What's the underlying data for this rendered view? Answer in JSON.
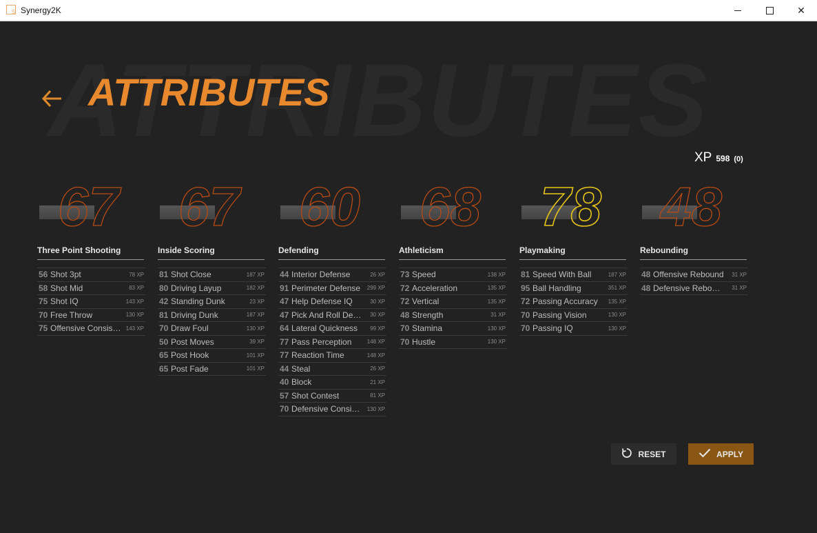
{
  "window": {
    "title": "Synergy2K",
    "icon_letter": "S"
  },
  "header": {
    "background_word": "ATTRIBUTES",
    "title": "ATTRIBUTES",
    "back_icon": "arrow-left-icon"
  },
  "xp": {
    "label": "XP",
    "value": "598",
    "pending": "(0)"
  },
  "colors": {
    "accent": "#e8892e",
    "outline": "#b84a14",
    "highlight": "#e8c419",
    "apply_bg": "#8a5613"
  },
  "categories": [
    {
      "name": "Three Point Shooting",
      "rating": "67",
      "highlight": false,
      "attributes": [
        {
          "value": "56",
          "name": "Shot 3pt",
          "xp": "78 XP"
        },
        {
          "value": "58",
          "name": "Shot Mid",
          "xp": "83 XP"
        },
        {
          "value": "75",
          "name": "Shot IQ",
          "xp": "143 XP"
        },
        {
          "value": "70",
          "name": "Free Throw",
          "xp": "130 XP"
        },
        {
          "value": "75",
          "name": "Offensive Consiste...",
          "xp": "143 XP"
        }
      ]
    },
    {
      "name": "Inside Scoring",
      "rating": "67",
      "highlight": false,
      "attributes": [
        {
          "value": "81",
          "name": "Shot Close",
          "xp": "187 XP"
        },
        {
          "value": "80",
          "name": "Driving Layup",
          "xp": "182 XP"
        },
        {
          "value": "42",
          "name": "Standing Dunk",
          "xp": "23 XP"
        },
        {
          "value": "81",
          "name": "Driving Dunk",
          "xp": "187 XP"
        },
        {
          "value": "70",
          "name": "Draw Foul",
          "xp": "130 XP"
        },
        {
          "value": "50",
          "name": "Post Moves",
          "xp": "39 XP"
        },
        {
          "value": "65",
          "name": "Post Hook",
          "xp": "101 XP"
        },
        {
          "value": "65",
          "name": "Post Fade",
          "xp": "101 XP"
        }
      ]
    },
    {
      "name": "Defending",
      "rating": "60",
      "highlight": false,
      "attributes": [
        {
          "value": "44",
          "name": "Interior Defense",
          "xp": "26 XP"
        },
        {
          "value": "91",
          "name": "Perimeter Defense",
          "xp": "299 XP"
        },
        {
          "value": "47",
          "name": "Help Defense IQ",
          "xp": "30 XP"
        },
        {
          "value": "47",
          "name": "Pick And Roll Defen...",
          "xp": "30 XP"
        },
        {
          "value": "64",
          "name": "Lateral Quickness",
          "xp": "99 XP"
        },
        {
          "value": "77",
          "name": "Pass Perception",
          "xp": "148 XP"
        },
        {
          "value": "77",
          "name": "Reaction Time",
          "xp": "148 XP"
        },
        {
          "value": "44",
          "name": "Steal",
          "xp": "26 XP"
        },
        {
          "value": "40",
          "name": "Block",
          "xp": "21 XP"
        },
        {
          "value": "57",
          "name": "Shot Contest",
          "xp": "81 XP"
        },
        {
          "value": "70",
          "name": "Defensive Consiste...",
          "xp": "130 XP"
        }
      ]
    },
    {
      "name": "Athleticism",
      "rating": "68",
      "highlight": false,
      "attributes": [
        {
          "value": "73",
          "name": "Speed",
          "xp": "138 XP"
        },
        {
          "value": "72",
          "name": "Acceleration",
          "xp": "135 XP"
        },
        {
          "value": "72",
          "name": "Vertical",
          "xp": "135 XP"
        },
        {
          "value": "48",
          "name": "Strength",
          "xp": "31 XP"
        },
        {
          "value": "70",
          "name": "Stamina",
          "xp": "130 XP"
        },
        {
          "value": "70",
          "name": "Hustle",
          "xp": "130 XP"
        }
      ]
    },
    {
      "name": "Playmaking",
      "rating": "78",
      "highlight": true,
      "attributes": [
        {
          "value": "81",
          "name": "Speed With Ball",
          "xp": "187 XP"
        },
        {
          "value": "95",
          "name": "Ball Handling",
          "xp": "351 XP"
        },
        {
          "value": "72",
          "name": "Passing Accuracy",
          "xp": "135 XP"
        },
        {
          "value": "70",
          "name": "Passing Vision",
          "xp": "130 XP"
        },
        {
          "value": "70",
          "name": "Passing IQ",
          "xp": "130 XP"
        }
      ]
    },
    {
      "name": "Rebounding",
      "rating": "48",
      "highlight": false,
      "attributes": [
        {
          "value": "48",
          "name": "Offensive Rebound",
          "xp": "31 XP"
        },
        {
          "value": "48",
          "name": "Defensive Rebound",
          "xp": "31 XP"
        }
      ]
    }
  ],
  "buttons": {
    "reset": {
      "label": "RESET",
      "icon": "reset-icon"
    },
    "apply": {
      "label": "APPLY",
      "icon": "check-icon"
    }
  }
}
